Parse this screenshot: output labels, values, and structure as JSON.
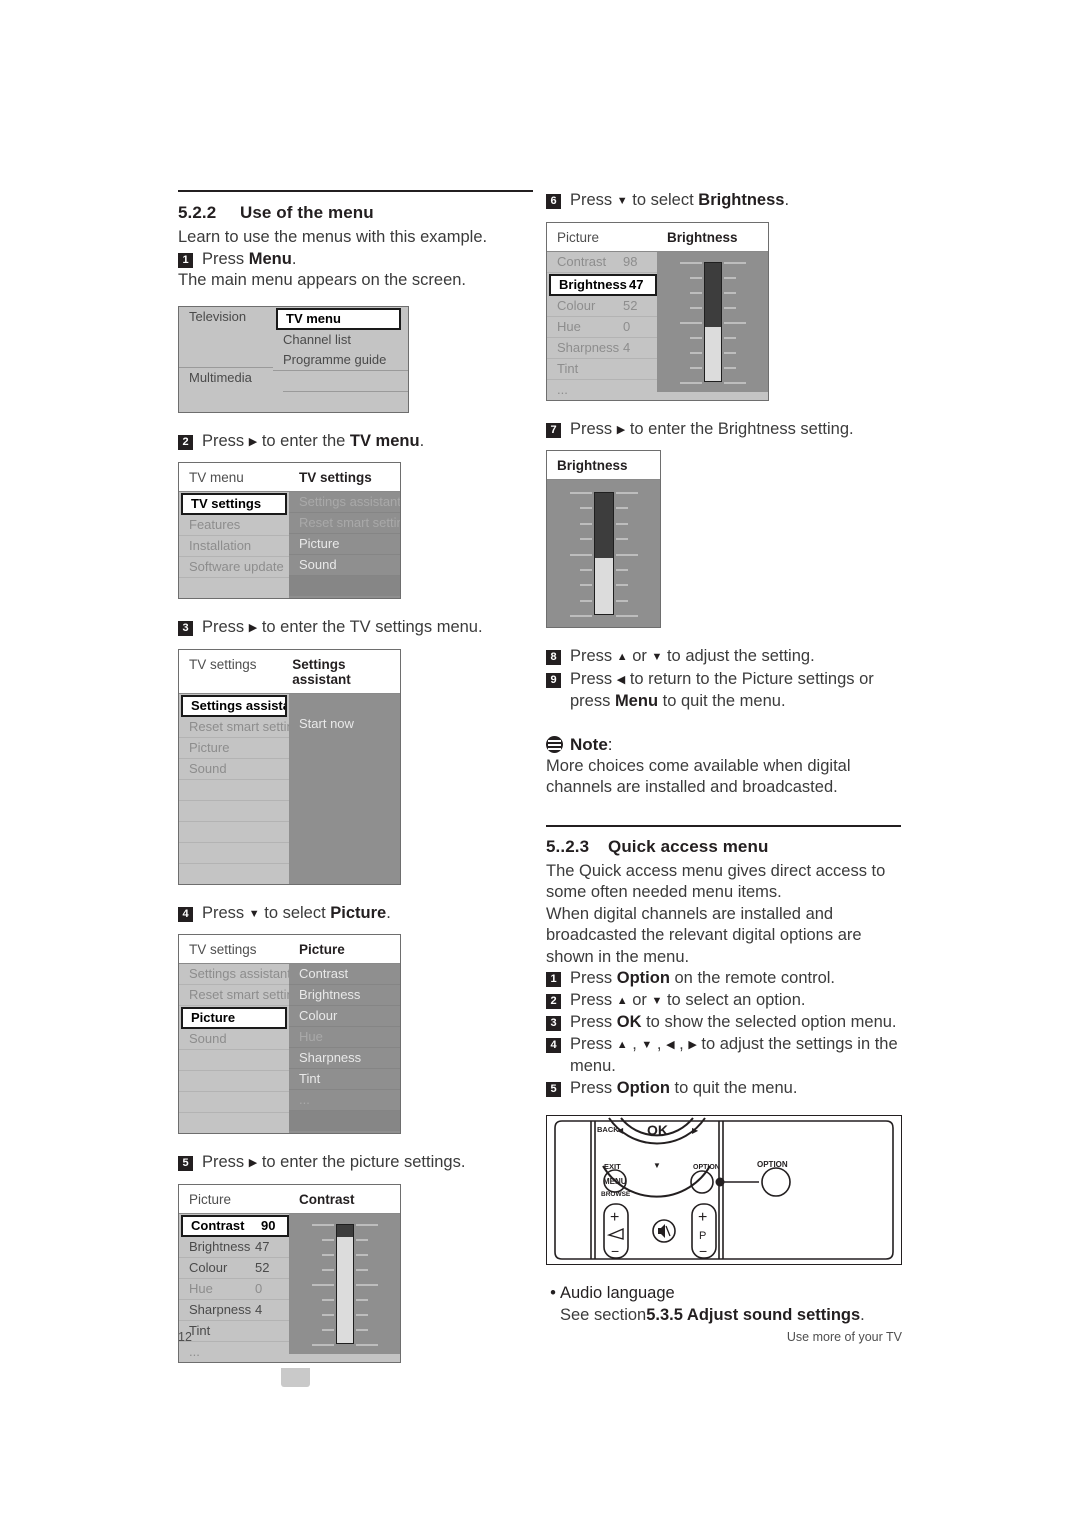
{
  "page": {
    "number": "12",
    "running_title": "Use more of your TV"
  },
  "sections": {
    "use_of_menu": {
      "number": "5.2.2",
      "title": "Use of the menu",
      "intro": "Learn to use the menus with this example.",
      "after_step1": "The main menu appears on the screen."
    },
    "quick_access": {
      "number": "5..2.3",
      "title": "Quick access menu",
      "para1": "The Quick access menu gives direct access to some often needed menu items.",
      "para2": "When digital channels are installed and broadcasted the relevant digital options are shown in the menu."
    }
  },
  "note": {
    "icon": "note-icon",
    "label": "Note",
    "colon": ":",
    "text": "More choices come available when digital channels are installed and broadcasted."
  },
  "steps_left": [
    {
      "n": "1",
      "pre": "Press ",
      "bold": "Menu",
      "post": "."
    },
    {
      "n": "2",
      "pre": "Press ",
      "arrow": "▶",
      "mid": " to enter the ",
      "bold": "TV menu",
      "post": "."
    },
    {
      "n": "3",
      "pre": "Press ",
      "arrow": "▶",
      "mid": " to enter the TV settings menu.",
      "bold": "",
      "post": ""
    },
    {
      "n": "4",
      "pre": "Press ",
      "arrow": "▼",
      "mid": " to select ",
      "bold": "Picture",
      "post": "."
    },
    {
      "n": "5",
      "pre": "Press ",
      "arrow": "▶",
      "mid": " to enter the picture settings.",
      "bold": "",
      "post": ""
    }
  ],
  "steps_right": [
    {
      "n": "6",
      "pre": "Press ",
      "arrow": "▼",
      "mid": " to select ",
      "bold": "Brightness",
      "post": "."
    },
    {
      "n": "7",
      "pre": "Press ",
      "arrow": "▶",
      "mid": " to enter the Brightness setting.",
      "bold": "",
      "post": ""
    },
    {
      "n": "8",
      "pre": "Press ",
      "arrow": "▲",
      "mid": " or ",
      "arrow2": "▼",
      "mid2": " to adjust the setting.",
      "bold": "",
      "post": ""
    },
    {
      "n": "9",
      "pre": "Press ",
      "arrow": "◀",
      "mid": " to return to the Picture settings or press ",
      "bold": "Menu",
      "post": " to quit the menu."
    }
  ],
  "steps_quick": [
    {
      "n": "1",
      "pre": "Press ",
      "bold": "Option",
      "post": " on the remote control."
    },
    {
      "n": "2",
      "pre": "Press ",
      "arrow": "▲",
      "mid": " or ",
      "arrow2": "▼",
      "mid2": " to select an option."
    },
    {
      "n": "3",
      "pre": "Press ",
      "bold": "OK",
      "post": " to show the selected option menu."
    },
    {
      "n": "4",
      "pre": "Press ",
      "arrow": "▲",
      "mid": " , ",
      "arrow2": "▼",
      "mid2": " , ",
      "arrow3": "◀",
      "mid3": " , ",
      "arrow4": "▶",
      "mid4": " to adjust the settings in the menu."
    },
    {
      "n": "5",
      "pre": "Press ",
      "bold": "Option",
      "post": " to quit the menu."
    }
  ],
  "audio_language": {
    "bullet": "•",
    "title": "Audio language",
    "see_pre": "See section ",
    "see_bold": "5.3.5 Adjust sound settings",
    "see_post": "."
  },
  "osd_main_menu": {
    "left_col": [
      "Television",
      "",
      "",
      "Multimedia",
      ""
    ],
    "right_col": [
      "TV menu",
      "Channel list",
      "Programme guide",
      "",
      ""
    ],
    "selected": "TV menu"
  },
  "osd_tv_menu": {
    "header_left": "TV menu",
    "header_right": "TV settings",
    "left_items": [
      "TV settings",
      "Features",
      "Installation",
      "Software update",
      ""
    ],
    "right_items": [
      "Settings assistant",
      "Reset smart settings",
      "Picture",
      "Sound",
      ""
    ],
    "selected": "TV settings"
  },
  "osd_settings_assistant": {
    "header_left": "TV settings",
    "header_right": "Settings assistant",
    "left_items": [
      "Settings assistant",
      "Reset smart settings",
      "Picture",
      "Sound",
      "",
      "",
      "",
      "",
      ""
    ],
    "right_items": [
      "",
      "Start now",
      "",
      "",
      "",
      "",
      "",
      "",
      ""
    ],
    "selected": "Settings assistant"
  },
  "osd_picture_list": {
    "header_left": "TV settings",
    "header_right": "Picture",
    "left_items": [
      "Settings assistant",
      "Reset smart settings",
      "Picture",
      "Sound",
      "",
      "",
      "",
      ""
    ],
    "right_items": [
      "Contrast",
      "Brightness",
      "Colour",
      "Hue",
      "Sharpness",
      "Tint",
      "...",
      ""
    ],
    "right_dim_index": 3,
    "selected": "Picture"
  },
  "osd_contrast": {
    "header_left": "Picture",
    "header_right": "Contrast",
    "items": [
      {
        "label": "Contrast",
        "value": "90",
        "selected": true,
        "dim": false
      },
      {
        "label": "Brightness",
        "value": "47",
        "selected": false,
        "dim": false
      },
      {
        "label": "Colour",
        "value": "52",
        "selected": false,
        "dim": false
      },
      {
        "label": "Hue",
        "value": "0",
        "selected": false,
        "dim": true
      },
      {
        "label": "Sharpness",
        "value": "4",
        "selected": false,
        "dim": false
      },
      {
        "label": "Tint",
        "value": "",
        "selected": false,
        "dim": false
      },
      {
        "label": "...",
        "value": "",
        "selected": false,
        "dim": false
      }
    ],
    "slider_value": 90
  },
  "osd_brightness_list": {
    "header_left": "Picture",
    "header_right": "Brightness",
    "items": [
      {
        "label": "Contrast",
        "value": "98",
        "selected": false,
        "dim": true
      },
      {
        "label": "Brightness",
        "value": "47",
        "selected": true,
        "dim": false
      },
      {
        "label": "Colour",
        "value": "52",
        "selected": false,
        "dim": true
      },
      {
        "label": "Hue",
        "value": "0",
        "selected": false,
        "dim": true
      },
      {
        "label": "Sharpness",
        "value": "4",
        "selected": false,
        "dim": true
      },
      {
        "label": "Tint",
        "value": "",
        "selected": false,
        "dim": true
      },
      {
        "label": "...",
        "value": "",
        "selected": false,
        "dim": true
      }
    ],
    "slider_value": 47
  },
  "osd_brightness_panel": {
    "header": "Brightness",
    "slider_value": 47
  },
  "remote": {
    "labels": {
      "back": "BACK",
      "ok": "OK",
      "exit": "EXIT",
      "menu": "MENU",
      "browse": "BROWSE",
      "option_on_remote": "OPTION",
      "option_callout": "OPTION",
      "volume_plus": "+",
      "volume_minus": "−",
      "program_plus": "+",
      "program_minus": "−",
      "program_letter": "P",
      "left_arrow": "◀",
      "right_arrow": "▶",
      "down_arrow": "▼"
    }
  }
}
